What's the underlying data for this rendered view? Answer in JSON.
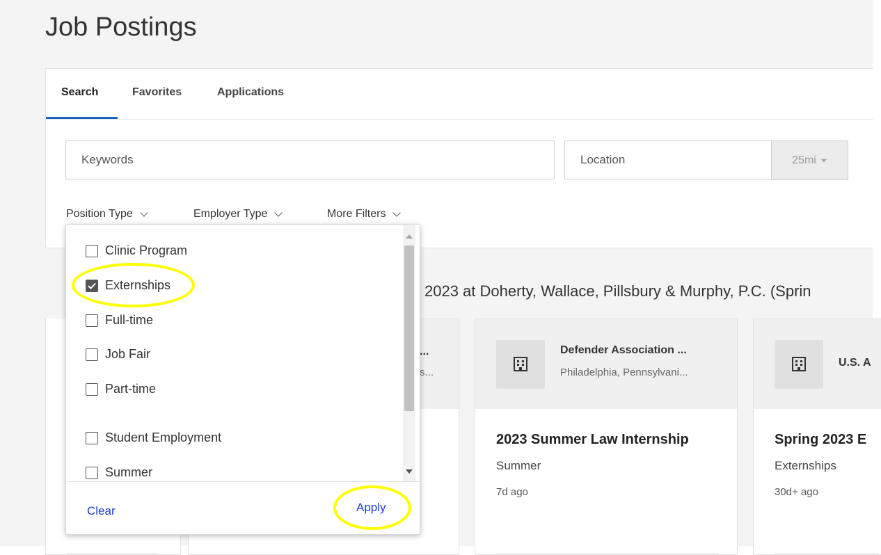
{
  "page": {
    "title": "Job Postings"
  },
  "tabs": [
    {
      "label": "Search",
      "active": true
    },
    {
      "label": "Favorites"
    },
    {
      "label": "Applications"
    }
  ],
  "search": {
    "keywords_placeholder": "Keywords",
    "keywords_value": "",
    "location_placeholder": "Location",
    "location_value": "",
    "radius": "25mi"
  },
  "filters": {
    "position_type": "Position Type",
    "employer_type": "Employer Type",
    "more_filters": "More Filters"
  },
  "dropdown": {
    "options": [
      {
        "label": "Clinic Program",
        "checked": false
      },
      {
        "label": "Externships",
        "checked": true
      },
      {
        "label": "Full-time",
        "checked": false
      },
      {
        "label": "Job Fair",
        "checked": false
      },
      {
        "label": "Part-time",
        "checked": false
      },
      {
        "label": "Student Employment",
        "checked": false
      },
      {
        "label": "Summer",
        "checked": false
      }
    ],
    "clear_label": "Clear",
    "apply_label": "Apply"
  },
  "results": {
    "heading": "2023 at Doherty, Wallace, Pillsbury & Murphy, P.C. (Sprin",
    "cards": [
      {
        "employer": "Defender Association ...",
        "location": "Philadelphia, Pennsylvani...",
        "title": "2023 Summer Law Internship",
        "type": "Summer",
        "posted": "7d ago"
      },
      {
        "employer": "U.S. A",
        "location": "",
        "title": "Spring 2023 E",
        "type": "Externships",
        "posted": "30d+ ago"
      }
    ],
    "partial_card": {
      "employer_tail": "...",
      "location_tail": "s..."
    }
  },
  "colors": {
    "accent": "#1565c0",
    "link": "#1e3fc4",
    "highlight": "#ffff00",
    "page_bg": "#f4f4f4"
  },
  "icons": {
    "building": "building-icon",
    "checkbox": "checkbox-icon",
    "chevron": "chevron-down-icon"
  }
}
